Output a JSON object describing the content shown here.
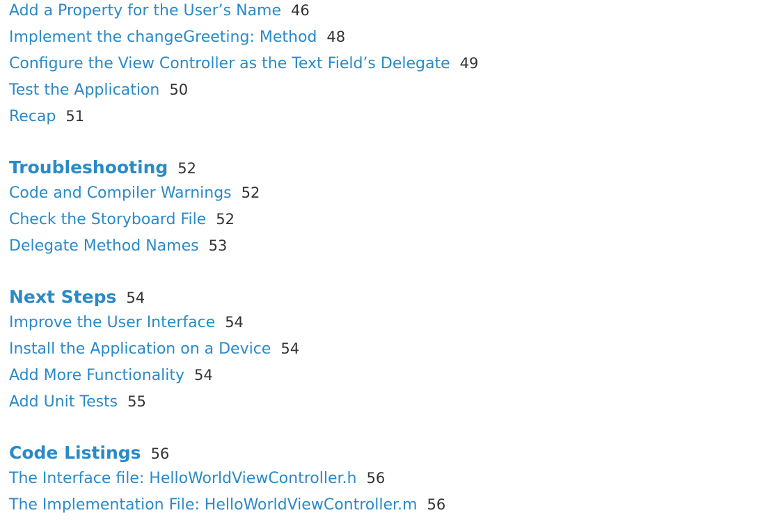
{
  "groups": [
    {
      "entries": [
        {
          "title": "Add a Property for the User’s Name",
          "page": "46"
        },
        {
          "title": "Implement the changeGreeting: Method",
          "page": "48"
        },
        {
          "title": "Configure the View Controller as the Text Field’s Delegate",
          "page": "49"
        },
        {
          "title": "Test the Application",
          "page": "50"
        },
        {
          "title": "Recap",
          "page": "51"
        }
      ]
    },
    {
      "section": {
        "title": "Troubleshooting",
        "page": "52"
      },
      "entries": [
        {
          "title": "Code and Compiler Warnings",
          "page": "52"
        },
        {
          "title": "Check the Storyboard File",
          "page": "52"
        },
        {
          "title": "Delegate Method Names",
          "page": "53"
        }
      ]
    },
    {
      "section": {
        "title": "Next Steps",
        "page": "54"
      },
      "entries": [
        {
          "title": "Improve the User Interface",
          "page": "54"
        },
        {
          "title": "Install the Application on a Device",
          "page": "54"
        },
        {
          "title": "Add More Functionality",
          "page": "54"
        },
        {
          "title": "Add Unit Tests",
          "page": "55"
        }
      ]
    },
    {
      "section": {
        "title": "Code Listings",
        "page": "56"
      },
      "entries": [
        {
          "title": "The Interface file: HelloWorldViewController.h",
          "page": "56"
        },
        {
          "title": "The Implementation File: HelloWorldViewController.m",
          "page": "56"
        }
      ]
    }
  ]
}
